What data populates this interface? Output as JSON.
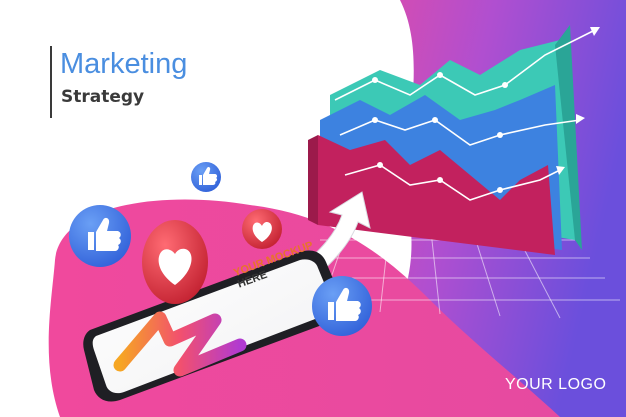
{
  "header": {
    "title": "Marketing",
    "subtitle": "Strategy"
  },
  "phone": {
    "screen_line1": "YOUR MOCKUP",
    "screen_line2": "HERE"
  },
  "footer": {
    "logo_text": "YOUR LOGO"
  },
  "colors": {
    "title_blue": "#4a8ee0",
    "subtitle_dark": "#3a3a3a",
    "pink": "#e8398d",
    "purple": "#7b4fd6",
    "teal": "#3cc9b6",
    "blue_layer": "#3d82e0",
    "magenta_layer": "#c2215e",
    "like_blue": "#3a6fe0",
    "heart_red": "#e2323f"
  },
  "icons": [
    "thumbs-up-icon",
    "heart-icon",
    "arrow-up-icon"
  ]
}
